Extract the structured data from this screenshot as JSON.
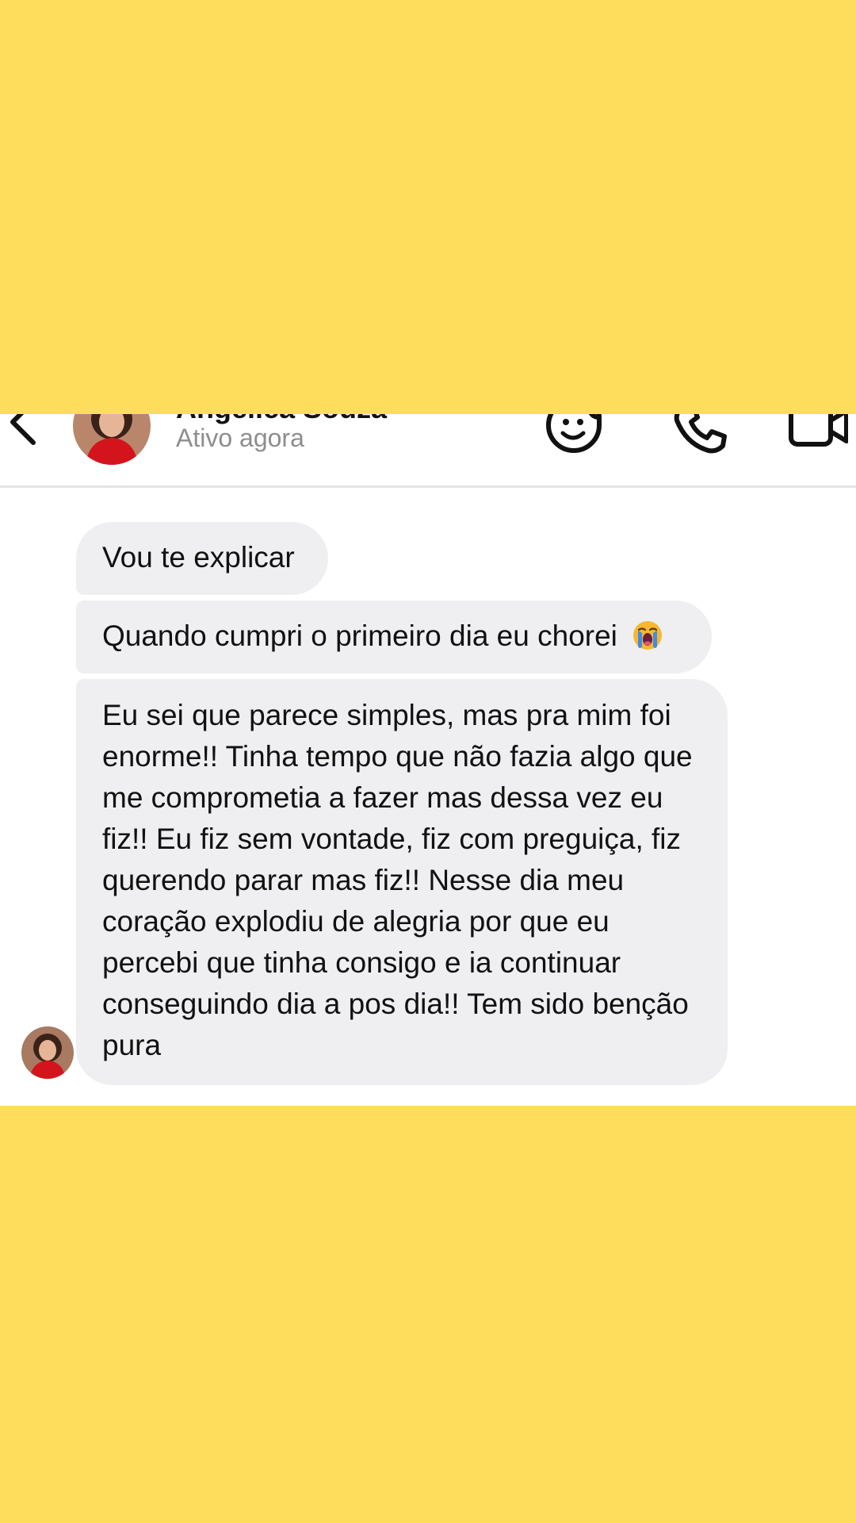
{
  "header": {
    "contact_name": "Angélica Souza",
    "status": "Ativo agora",
    "icons": [
      "back-arrow-icon",
      "avatar",
      "sticker-icon",
      "phone-icon",
      "video-icon"
    ]
  },
  "messages": [
    {
      "text": "Vou te explicar"
    },
    {
      "text": "Quando cumpri o primeiro dia eu chorei",
      "emoji": "loudly-crying-face"
    },
    {
      "text": "Eu sei que parece simples, mas pra mim foi enorme!! Tinha tempo que não fazia algo que me comprometia a fazer mas dessa vez eu fiz!! Eu fiz sem vontade, fiz com preguiça, fiz querendo parar mas fiz!! Nesse dia meu coração explodiu de alegria por que eu percebi que tinha consigo e ia continuar conseguindo dia a pos dia!! Tem sido benção pura"
    }
  ],
  "colors": {
    "background": "#FFDD5C",
    "screen": "#FFFFFF",
    "bubble": "#EFEFF2",
    "text": "#111111",
    "status": "#8E8E8E"
  }
}
